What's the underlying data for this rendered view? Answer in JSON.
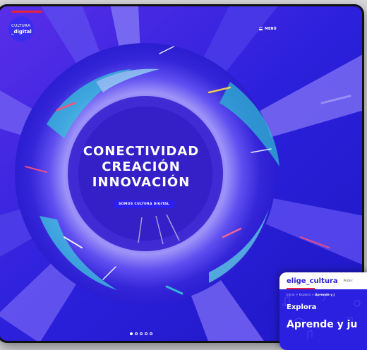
{
  "hero": {
    "logo_line1": "CULTURA",
    "logo_line2": "_digital",
    "menu_label": "MENÚ",
    "headline": [
      "CONECTIVIDAD",
      "CREACIÓN",
      "INNOVACIÓN"
    ],
    "cta_label": "SOMOS CULTURA DIGITAL",
    "slides": 5,
    "active_slide": 0,
    "colors": {
      "primary": "#2a1fd6",
      "accent": "#e8233a",
      "cyan": "#35c4d8",
      "violet": "#8a7bf2"
    }
  },
  "phone": {
    "brand": "elige_cultura",
    "nav_item": "Públic",
    "breadcrumb": [
      "Inicio",
      "Explora",
      "Aprende y j"
    ],
    "title": "Explora",
    "subtitle": "Aprende y ju"
  }
}
